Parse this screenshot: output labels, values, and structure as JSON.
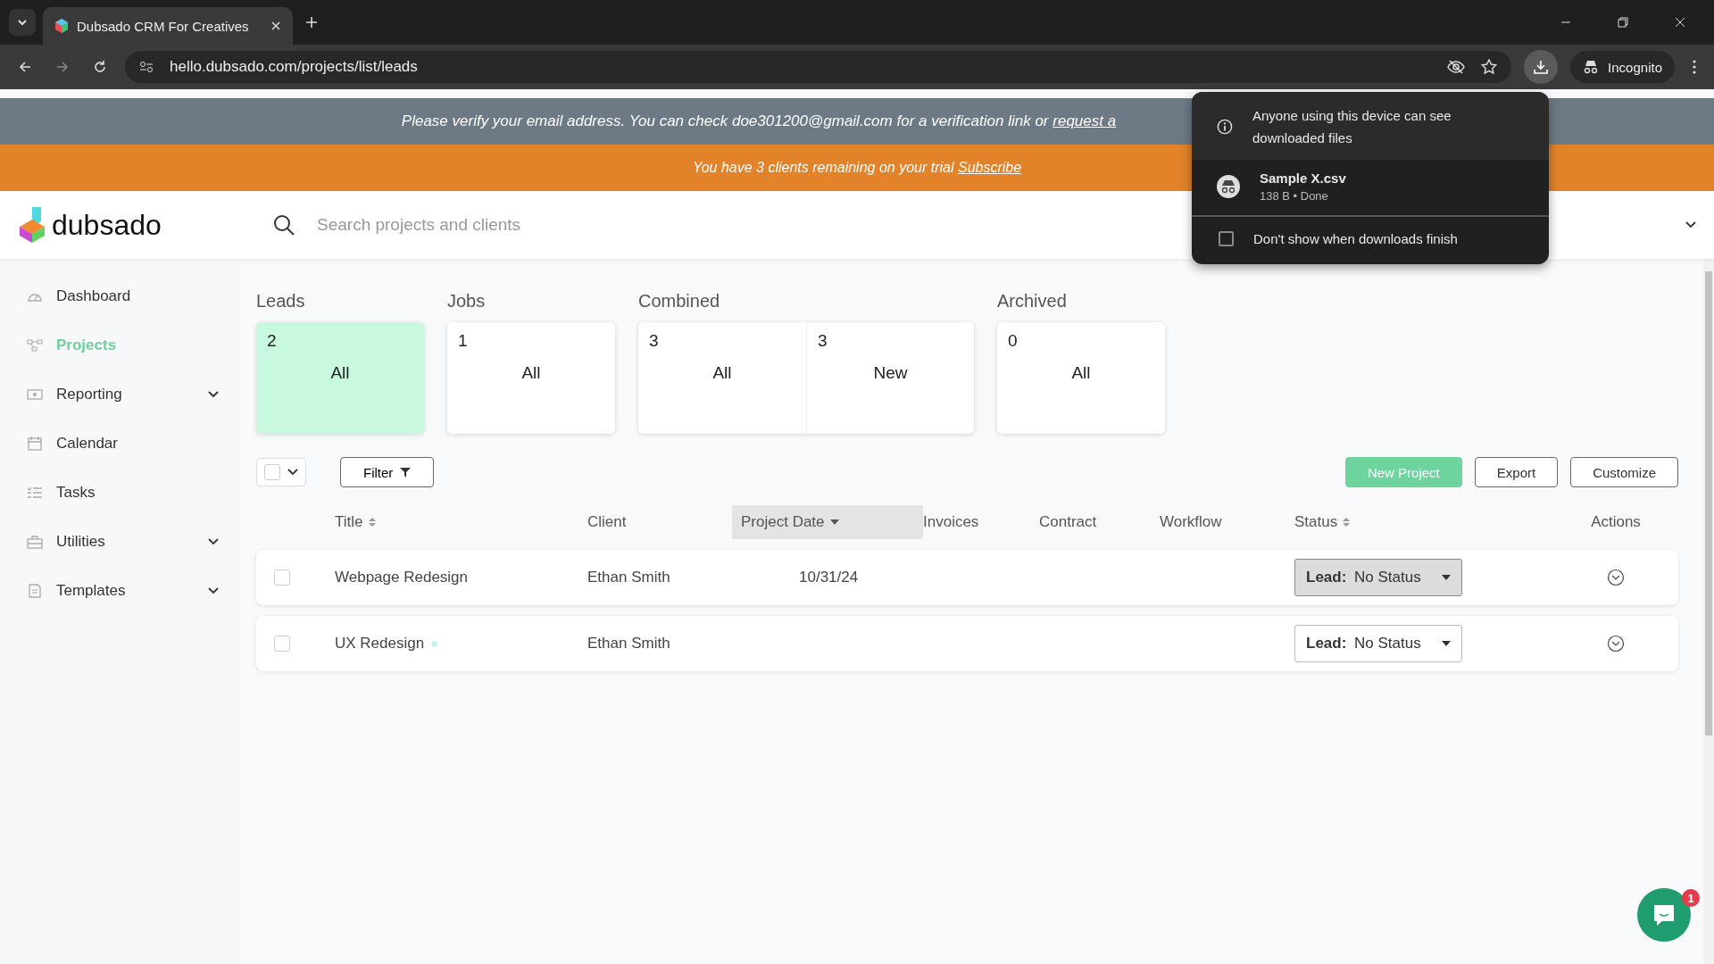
{
  "browser": {
    "tab_title": "Dubsado CRM For Creatives",
    "url": "hello.dubsado.com/projects/list/leads",
    "profile_label": "Incognito"
  },
  "verify_banner": {
    "text": "Please verify your email address. You can check doe301200@gmail.com for a verification link or",
    "link": "request a"
  },
  "trial_banner": {
    "text": "You have 3 clients remaining on your trial",
    "link": "Subscribe"
  },
  "logo": "dubsado",
  "search": {
    "placeholder": "Search projects and clients"
  },
  "sidebar": {
    "items": [
      {
        "label": "Dashboard",
        "selected": false,
        "expandable": false
      },
      {
        "label": "Projects",
        "selected": true,
        "expandable": false
      },
      {
        "label": "Reporting",
        "selected": false,
        "expandable": true
      },
      {
        "label": "Calendar",
        "selected": false,
        "expandable": false
      },
      {
        "label": "Tasks",
        "selected": false,
        "expandable": false
      },
      {
        "label": "Utilities",
        "selected": false,
        "expandable": true
      },
      {
        "label": "Templates",
        "selected": false,
        "expandable": true
      }
    ]
  },
  "count_groups": [
    {
      "label": "Leads",
      "cards": [
        {
          "count": "2",
          "label": "All",
          "selected": true
        }
      ]
    },
    {
      "label": "Jobs",
      "cards": [
        {
          "count": "1",
          "label": "All",
          "selected": false
        }
      ]
    },
    {
      "label": "Combined",
      "cards": [
        {
          "count": "3",
          "label": "All",
          "selected": false
        },
        {
          "count": "3",
          "label": "New",
          "selected": false
        }
      ]
    },
    {
      "label": "Archived",
      "cards": [
        {
          "count": "0",
          "label": "All",
          "selected": false
        }
      ]
    }
  ],
  "toolbar": {
    "select_all_checked": false,
    "filter": "Filter",
    "buttons": [
      {
        "label": "New Project",
        "kind": "primary"
      },
      {
        "label": "Export",
        "kind": "outline"
      },
      {
        "label": "Customize",
        "kind": "outline"
      }
    ]
  },
  "table": {
    "columns": [
      {
        "label": "Title",
        "sortable": true,
        "sorted": false
      },
      {
        "label": "Client",
        "sortable": false,
        "sorted": false
      },
      {
        "label": "Project Date",
        "sortable": false,
        "sorted": true
      },
      {
        "label": "Invoices",
        "sortable": false,
        "sorted": false
      },
      {
        "label": "Contract",
        "sortable": false,
        "sorted": false
      },
      {
        "label": "Workflow",
        "sortable": false,
        "sorted": false
      },
      {
        "label": "Status",
        "sortable": true,
        "sorted": false
      },
      {
        "label": "Actions",
        "sortable": false,
        "sorted": false
      }
    ],
    "rows": [
      {
        "checked": false,
        "title": "Webpage Redesign",
        "new_marker": false,
        "client": "Ethan Smith",
        "project_date": "10/31/24",
        "status_prefix": "Lead:",
        "status": "No Status",
        "status_hovered": true
      },
      {
        "checked": false,
        "title": "UX Redesign",
        "new_marker": true,
        "client": "Ethan Smith",
        "status_prefix": "Lead:",
        "status": "No Status",
        "status_hovered": false
      }
    ]
  },
  "downloads_popup": {
    "notice": "Anyone using this device can see downloaded files",
    "file_name": "Sample X.csv",
    "file_meta": "138 B • Done",
    "dont_show_label": "Don't show when downloads finish",
    "dont_show_checked": false
  },
  "chat": {
    "badge": "1"
  }
}
